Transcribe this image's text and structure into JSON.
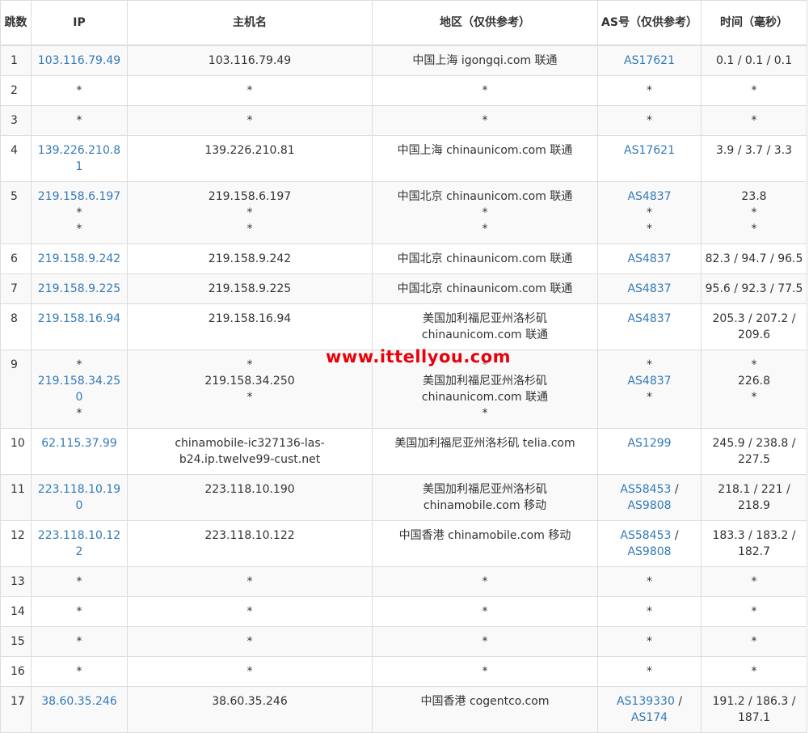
{
  "headers": {
    "hop": "跳数",
    "ip": "IP",
    "host": "主机名",
    "region": "地区（仅供参考）",
    "as": "AS号（仅供参考）",
    "time": "时间（毫秒）"
  },
  "watermark": "www.ittellyou.com",
  "rows": [
    {
      "hop": "1",
      "ip": [
        "103.116.79.49"
      ],
      "host": [
        "103.116.79.49"
      ],
      "region": [
        "中国上海 igongqi.com 联通"
      ],
      "as": [
        [
          "AS17621"
        ]
      ],
      "time": [
        "0.1 / 0.1 / 0.1"
      ]
    },
    {
      "hop": "2",
      "ip": [
        "*"
      ],
      "host": [
        "*"
      ],
      "region": [
        "*"
      ],
      "as": [
        [
          "*"
        ]
      ],
      "time": [
        "*"
      ]
    },
    {
      "hop": "3",
      "ip": [
        "*"
      ],
      "host": [
        "*"
      ],
      "region": [
        "*"
      ],
      "as": [
        [
          "*"
        ]
      ],
      "time": [
        "*"
      ]
    },
    {
      "hop": "4",
      "ip": [
        "139.226.210.81"
      ],
      "host": [
        "139.226.210.81"
      ],
      "region": [
        "中国上海 chinaunicom.com 联通"
      ],
      "as": [
        [
          "AS17621"
        ]
      ],
      "time": [
        "3.9 / 3.7 / 3.3"
      ]
    },
    {
      "hop": "5",
      "ip": [
        "219.158.6.197",
        "*",
        "*"
      ],
      "host": [
        "219.158.6.197",
        "*",
        "*"
      ],
      "region": [
        "中国北京 chinaunicom.com 联通",
        "*",
        "*"
      ],
      "as": [
        [
          "AS4837"
        ],
        [
          "*"
        ],
        [
          "*"
        ]
      ],
      "time": [
        "23.8",
        "*",
        "*"
      ]
    },
    {
      "hop": "6",
      "ip": [
        "219.158.9.242"
      ],
      "host": [
        "219.158.9.242"
      ],
      "region": [
        "中国北京 chinaunicom.com 联通"
      ],
      "as": [
        [
          "AS4837"
        ]
      ],
      "time": [
        "82.3 / 94.7 / 96.5"
      ]
    },
    {
      "hop": "7",
      "ip": [
        "219.158.9.225"
      ],
      "host": [
        "219.158.9.225"
      ],
      "region": [
        "中国北京 chinaunicom.com 联通"
      ],
      "as": [
        [
          "AS4837"
        ]
      ],
      "time": [
        "95.6 / 92.3 / 77.5"
      ]
    },
    {
      "hop": "8",
      "ip": [
        "219.158.16.94"
      ],
      "host": [
        "219.158.16.94"
      ],
      "region": [
        "美国加利福尼亚州洛杉矶 chinaunicom.com 联通"
      ],
      "as": [
        [
          "AS4837"
        ]
      ],
      "time": [
        "205.3 / 207.2 / 209.6"
      ]
    },
    {
      "hop": "9",
      "ip": [
        "*",
        "219.158.34.250",
        "*"
      ],
      "host": [
        "*",
        "219.158.34.250",
        "*"
      ],
      "region": [
        "*",
        "美国加利福尼亚州洛杉矶 chinaunicom.com 联通",
        "*"
      ],
      "as": [
        [
          "*"
        ],
        [
          "AS4837"
        ],
        [
          "*"
        ]
      ],
      "time": [
        "*",
        "226.8",
        "*"
      ]
    },
    {
      "hop": "10",
      "ip": [
        "62.115.37.99"
      ],
      "host": [
        "chinamobile-ic327136-las-b24.ip.twelve99-cust.net"
      ],
      "region": [
        "美国加利福尼亚州洛杉矶 telia.com"
      ],
      "as": [
        [
          "AS1299"
        ]
      ],
      "time": [
        "245.9 / 238.8 / 227.5"
      ]
    },
    {
      "hop": "11",
      "ip": [
        "223.118.10.190"
      ],
      "host": [
        "223.118.10.190"
      ],
      "region": [
        "美国加利福尼亚州洛杉矶 chinamobile.com 移动"
      ],
      "as": [
        [
          "AS58453",
          "AS9808"
        ]
      ],
      "time": [
        "218.1 / 221 / 218.9"
      ]
    },
    {
      "hop": "12",
      "ip": [
        "223.118.10.122"
      ],
      "host": [
        "223.118.10.122"
      ],
      "region": [
        "中国香港 chinamobile.com 移动"
      ],
      "as": [
        [
          "AS58453",
          "AS9808"
        ]
      ],
      "time": [
        "183.3 / 183.2 / 182.7"
      ]
    },
    {
      "hop": "13",
      "ip": [
        "*"
      ],
      "host": [
        "*"
      ],
      "region": [
        "*"
      ],
      "as": [
        [
          "*"
        ]
      ],
      "time": [
        "*"
      ]
    },
    {
      "hop": "14",
      "ip": [
        "*"
      ],
      "host": [
        "*"
      ],
      "region": [
        "*"
      ],
      "as": [
        [
          "*"
        ]
      ],
      "time": [
        "*"
      ]
    },
    {
      "hop": "15",
      "ip": [
        "*"
      ],
      "host": [
        "*"
      ],
      "region": [
        "*"
      ],
      "as": [
        [
          "*"
        ]
      ],
      "time": [
        "*"
      ]
    },
    {
      "hop": "16",
      "ip": [
        "*"
      ],
      "host": [
        "*"
      ],
      "region": [
        "*"
      ],
      "as": [
        [
          "*"
        ]
      ],
      "time": [
        "*"
      ]
    },
    {
      "hop": "17",
      "ip": [
        "38.60.35.246"
      ],
      "host": [
        "38.60.35.246"
      ],
      "region": [
        "中国香港 cogentco.com"
      ],
      "as": [
        [
          "AS139330",
          "AS174"
        ]
      ],
      "time": [
        "191.2 / 186.3 / 187.1"
      ]
    }
  ]
}
